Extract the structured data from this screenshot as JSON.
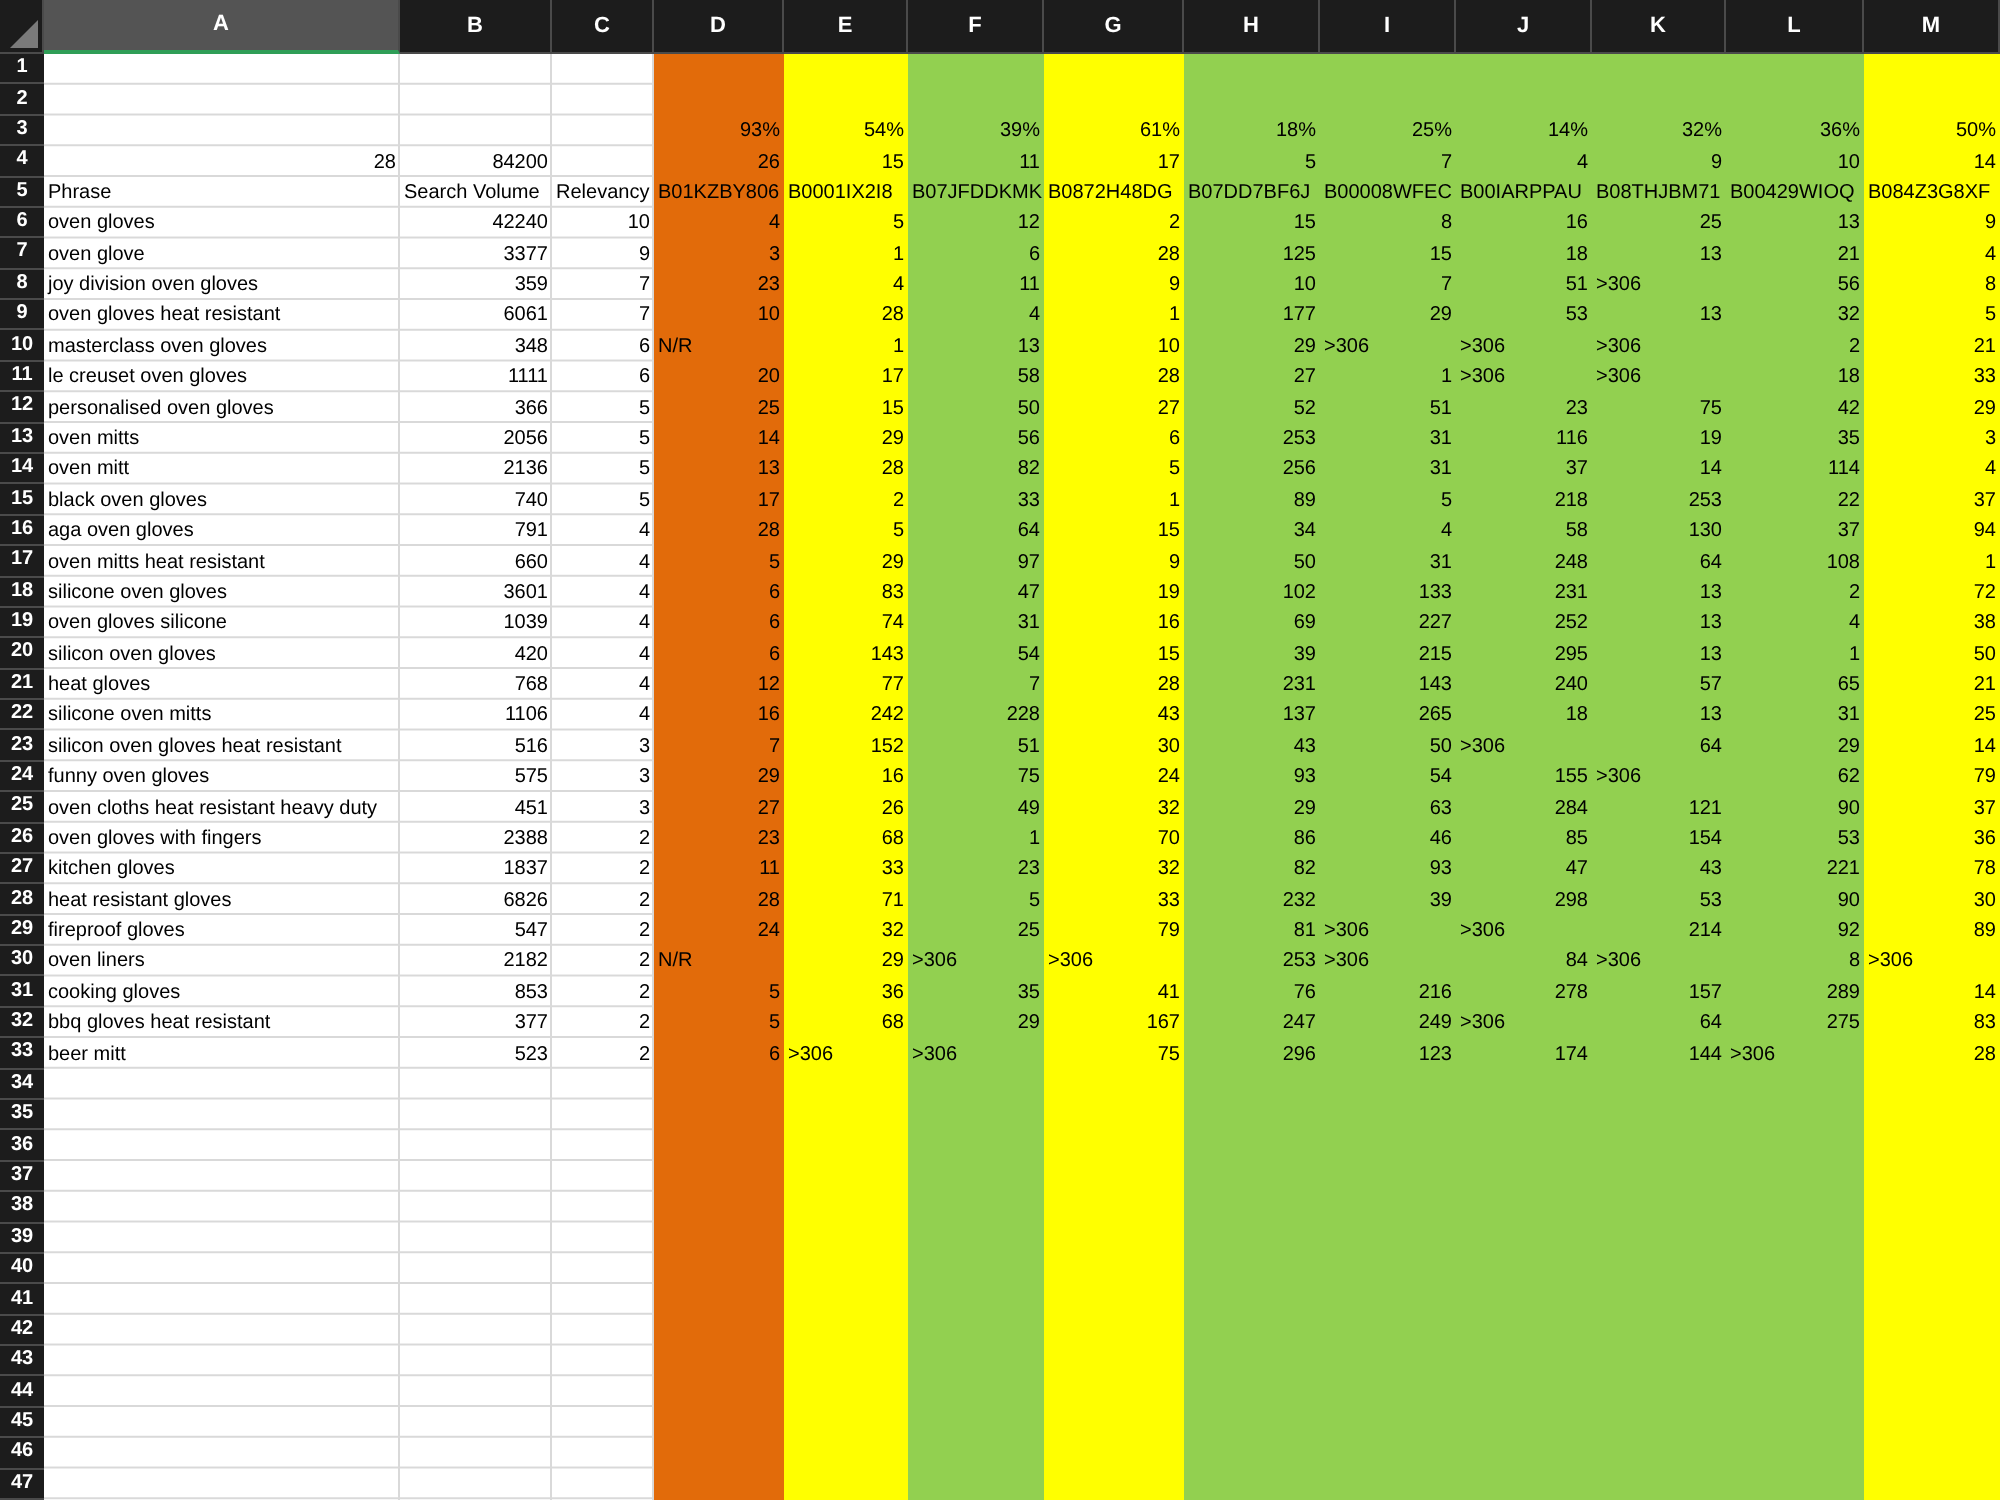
{
  "sheet": {
    "columns": [
      {
        "label": "A",
        "selected": true
      },
      {
        "label": "B",
        "selected": false
      },
      {
        "label": "C",
        "selected": false
      },
      {
        "label": "D",
        "selected": false,
        "color": "#e26b0a"
      },
      {
        "label": "E",
        "selected": false,
        "color": "#ffff00"
      },
      {
        "label": "F",
        "selected": false,
        "color": "#92d050"
      },
      {
        "label": "G",
        "selected": false,
        "color": "#ffff00"
      },
      {
        "label": "H",
        "selected": false,
        "color": "#92d050"
      },
      {
        "label": "I",
        "selected": false,
        "color": "#92d050"
      },
      {
        "label": "J",
        "selected": false,
        "color": "#92d050"
      },
      {
        "label": "K",
        "selected": false,
        "color": "#92d050"
      },
      {
        "label": "L",
        "selected": false,
        "color": "#92d050"
      },
      {
        "label": "M",
        "selected": false,
        "color": "#ffff00"
      }
    ],
    "rows": [
      {
        "number": "1"
      },
      {
        "number": "2"
      },
      {
        "number": "3",
        "cells": [
          null,
          null,
          null,
          {
            "kind": "number",
            "text": "93%"
          },
          {
            "kind": "number",
            "text": "54%"
          },
          {
            "kind": "number",
            "text": "39%"
          },
          {
            "kind": "number",
            "text": "61%"
          },
          {
            "kind": "number",
            "text": "18%"
          },
          {
            "kind": "number",
            "text": "25%"
          },
          {
            "kind": "number",
            "text": "14%"
          },
          {
            "kind": "number",
            "text": "32%"
          },
          {
            "kind": "number",
            "text": "36%"
          },
          {
            "kind": "number",
            "text": "50%"
          }
        ]
      },
      {
        "number": "4",
        "cells": [
          {
            "kind": "number",
            "text": "28"
          },
          {
            "kind": "number",
            "text": "84200"
          },
          null,
          {
            "kind": "number",
            "text": "26"
          },
          {
            "kind": "number",
            "text": "15"
          },
          {
            "kind": "number",
            "text": "11"
          },
          {
            "kind": "number",
            "text": "17"
          },
          {
            "kind": "number",
            "text": "5"
          },
          {
            "kind": "number",
            "text": "7"
          },
          {
            "kind": "number",
            "text": "4"
          },
          {
            "kind": "number",
            "text": "9"
          },
          {
            "kind": "number",
            "text": "10"
          },
          {
            "kind": "number",
            "text": "14"
          }
        ]
      },
      {
        "number": "5",
        "cells": [
          {
            "kind": "text",
            "text": "Phrase"
          },
          {
            "kind": "text",
            "text": "Search Volume"
          },
          {
            "kind": "text",
            "text": "Relevancy"
          },
          {
            "kind": "text",
            "text": "B01KZBY806"
          },
          {
            "kind": "text",
            "text": "B0001IX2I8"
          },
          {
            "kind": "text",
            "text": "B07JFDDKMK"
          },
          {
            "kind": "text",
            "text": "B0872H48DG"
          },
          {
            "kind": "text",
            "text": "B07DD7BF6J"
          },
          {
            "kind": "text",
            "text": "B00008WFEC"
          },
          {
            "kind": "text",
            "text": "B00IARPPAU"
          },
          {
            "kind": "text",
            "text": "B08THJBM71"
          },
          {
            "kind": "text",
            "text": "B00429WIOQ"
          },
          {
            "kind": "text",
            "text": "B084Z3G8XF"
          }
        ]
      },
      {
        "number": "6",
        "cells": [
          {
            "kind": "text",
            "text": "oven gloves"
          },
          {
            "kind": "number",
            "text": "42240"
          },
          {
            "kind": "number",
            "text": "10"
          },
          {
            "kind": "number",
            "text": "4"
          },
          {
            "kind": "number",
            "text": "5"
          },
          {
            "kind": "number",
            "text": "12"
          },
          {
            "kind": "number",
            "text": "2"
          },
          {
            "kind": "number",
            "text": "15"
          },
          {
            "kind": "number",
            "text": "8"
          },
          {
            "kind": "number",
            "text": "16"
          },
          {
            "kind": "number",
            "text": "25"
          },
          {
            "kind": "number",
            "text": "13"
          },
          {
            "kind": "number",
            "text": "9"
          }
        ]
      },
      {
        "number": "7",
        "cells": [
          {
            "kind": "text",
            "text": "oven glove"
          },
          {
            "kind": "number",
            "text": "3377"
          },
          {
            "kind": "number",
            "text": "9"
          },
          {
            "kind": "number",
            "text": "3"
          },
          {
            "kind": "number",
            "text": "1"
          },
          {
            "kind": "number",
            "text": "6"
          },
          {
            "kind": "number",
            "text": "28"
          },
          {
            "kind": "number",
            "text": "125"
          },
          {
            "kind": "number",
            "text": "15"
          },
          {
            "kind": "number",
            "text": "18"
          },
          {
            "kind": "number",
            "text": "13"
          },
          {
            "kind": "number",
            "text": "21"
          },
          {
            "kind": "number",
            "text": "4"
          }
        ]
      },
      {
        "number": "8",
        "cells": [
          {
            "kind": "text",
            "text": "joy division oven gloves"
          },
          {
            "kind": "number",
            "text": "359"
          },
          {
            "kind": "number",
            "text": "7"
          },
          {
            "kind": "number",
            "text": "23"
          },
          {
            "kind": "number",
            "text": "4"
          },
          {
            "kind": "number",
            "text": "11"
          },
          {
            "kind": "number",
            "text": "9"
          },
          {
            "kind": "number",
            "text": "10"
          },
          {
            "kind": "number",
            "text": "7"
          },
          {
            "kind": "number",
            "text": "51"
          },
          {
            "kind": "text",
            "text": ">306"
          },
          {
            "kind": "number",
            "text": "56"
          },
          {
            "kind": "number",
            "text": "8"
          }
        ]
      },
      {
        "number": "9",
        "cells": [
          {
            "kind": "text",
            "text": "oven gloves heat resistant"
          },
          {
            "kind": "number",
            "text": "6061"
          },
          {
            "kind": "number",
            "text": "7"
          },
          {
            "kind": "number",
            "text": "10"
          },
          {
            "kind": "number",
            "text": "28"
          },
          {
            "kind": "number",
            "text": "4"
          },
          {
            "kind": "number",
            "text": "1"
          },
          {
            "kind": "number",
            "text": "177"
          },
          {
            "kind": "number",
            "text": "29"
          },
          {
            "kind": "number",
            "text": "53"
          },
          {
            "kind": "number",
            "text": "13"
          },
          {
            "kind": "number",
            "text": "32"
          },
          {
            "kind": "number",
            "text": "5"
          }
        ]
      },
      {
        "number": "10",
        "cells": [
          {
            "kind": "text",
            "text": "masterclass oven gloves"
          },
          {
            "kind": "number",
            "text": "348"
          },
          {
            "kind": "number",
            "text": "6"
          },
          {
            "kind": "text",
            "text": "N/R"
          },
          {
            "kind": "number",
            "text": "1"
          },
          {
            "kind": "number",
            "text": "13"
          },
          {
            "kind": "number",
            "text": "10"
          },
          {
            "kind": "number",
            "text": "29"
          },
          {
            "kind": "text",
            "text": ">306"
          },
          {
            "kind": "text",
            "text": ">306"
          },
          {
            "kind": "text",
            "text": ">306"
          },
          {
            "kind": "number",
            "text": "2"
          },
          {
            "kind": "number",
            "text": "21"
          }
        ]
      },
      {
        "number": "11",
        "cells": [
          {
            "kind": "text",
            "text": "le creuset oven gloves"
          },
          {
            "kind": "number",
            "text": "1111"
          },
          {
            "kind": "number",
            "text": "6"
          },
          {
            "kind": "number",
            "text": "20"
          },
          {
            "kind": "number",
            "text": "17"
          },
          {
            "kind": "number",
            "text": "58"
          },
          {
            "kind": "number",
            "text": "28"
          },
          {
            "kind": "number",
            "text": "27"
          },
          {
            "kind": "number",
            "text": "1"
          },
          {
            "kind": "text",
            "text": ">306"
          },
          {
            "kind": "text",
            "text": ">306"
          },
          {
            "kind": "number",
            "text": "18"
          },
          {
            "kind": "number",
            "text": "33"
          }
        ]
      },
      {
        "number": "12",
        "cells": [
          {
            "kind": "text",
            "text": "personalised oven gloves"
          },
          {
            "kind": "number",
            "text": "366"
          },
          {
            "kind": "number",
            "text": "5"
          },
          {
            "kind": "number",
            "text": "25"
          },
          {
            "kind": "number",
            "text": "15"
          },
          {
            "kind": "number",
            "text": "50"
          },
          {
            "kind": "number",
            "text": "27"
          },
          {
            "kind": "number",
            "text": "52"
          },
          {
            "kind": "number",
            "text": "51"
          },
          {
            "kind": "number",
            "text": "23"
          },
          {
            "kind": "number",
            "text": "75"
          },
          {
            "kind": "number",
            "text": "42"
          },
          {
            "kind": "number",
            "text": "29"
          }
        ]
      },
      {
        "number": "13",
        "cells": [
          {
            "kind": "text",
            "text": "oven mitts"
          },
          {
            "kind": "number",
            "text": "2056"
          },
          {
            "kind": "number",
            "text": "5"
          },
          {
            "kind": "number",
            "text": "14"
          },
          {
            "kind": "number",
            "text": "29"
          },
          {
            "kind": "number",
            "text": "56"
          },
          {
            "kind": "number",
            "text": "6"
          },
          {
            "kind": "number",
            "text": "253"
          },
          {
            "kind": "number",
            "text": "31"
          },
          {
            "kind": "number",
            "text": "116"
          },
          {
            "kind": "number",
            "text": "19"
          },
          {
            "kind": "number",
            "text": "35"
          },
          {
            "kind": "number",
            "text": "3"
          }
        ]
      },
      {
        "number": "14",
        "cells": [
          {
            "kind": "text",
            "text": "oven mitt"
          },
          {
            "kind": "number",
            "text": "2136"
          },
          {
            "kind": "number",
            "text": "5"
          },
          {
            "kind": "number",
            "text": "13"
          },
          {
            "kind": "number",
            "text": "28"
          },
          {
            "kind": "number",
            "text": "82"
          },
          {
            "kind": "number",
            "text": "5"
          },
          {
            "kind": "number",
            "text": "256"
          },
          {
            "kind": "number",
            "text": "31"
          },
          {
            "kind": "number",
            "text": "37"
          },
          {
            "kind": "number",
            "text": "14"
          },
          {
            "kind": "number",
            "text": "114"
          },
          {
            "kind": "number",
            "text": "4"
          }
        ]
      },
      {
        "number": "15",
        "cells": [
          {
            "kind": "text",
            "text": "black oven gloves"
          },
          {
            "kind": "number",
            "text": "740"
          },
          {
            "kind": "number",
            "text": "5"
          },
          {
            "kind": "number",
            "text": "17"
          },
          {
            "kind": "number",
            "text": "2"
          },
          {
            "kind": "number",
            "text": "33"
          },
          {
            "kind": "number",
            "text": "1"
          },
          {
            "kind": "number",
            "text": "89"
          },
          {
            "kind": "number",
            "text": "5"
          },
          {
            "kind": "number",
            "text": "218"
          },
          {
            "kind": "number",
            "text": "253"
          },
          {
            "kind": "number",
            "text": "22"
          },
          {
            "kind": "number",
            "text": "37"
          }
        ]
      },
      {
        "number": "16",
        "cells": [
          {
            "kind": "text",
            "text": "aga oven gloves"
          },
          {
            "kind": "number",
            "text": "791"
          },
          {
            "kind": "number",
            "text": "4"
          },
          {
            "kind": "number",
            "text": "28"
          },
          {
            "kind": "number",
            "text": "5"
          },
          {
            "kind": "number",
            "text": "64"
          },
          {
            "kind": "number",
            "text": "15"
          },
          {
            "kind": "number",
            "text": "34"
          },
          {
            "kind": "number",
            "text": "4"
          },
          {
            "kind": "number",
            "text": "58"
          },
          {
            "kind": "number",
            "text": "130"
          },
          {
            "kind": "number",
            "text": "37"
          },
          {
            "kind": "number",
            "text": "94"
          }
        ]
      },
      {
        "number": "17",
        "cells": [
          {
            "kind": "text",
            "text": "oven mitts heat resistant"
          },
          {
            "kind": "number",
            "text": "660"
          },
          {
            "kind": "number",
            "text": "4"
          },
          {
            "kind": "number",
            "text": "5"
          },
          {
            "kind": "number",
            "text": "29"
          },
          {
            "kind": "number",
            "text": "97"
          },
          {
            "kind": "number",
            "text": "9"
          },
          {
            "kind": "number",
            "text": "50"
          },
          {
            "kind": "number",
            "text": "31"
          },
          {
            "kind": "number",
            "text": "248"
          },
          {
            "kind": "number",
            "text": "64"
          },
          {
            "kind": "number",
            "text": "108"
          },
          {
            "kind": "number",
            "text": "1"
          }
        ]
      },
      {
        "number": "18",
        "cells": [
          {
            "kind": "text",
            "text": "silicone oven gloves"
          },
          {
            "kind": "number",
            "text": "3601"
          },
          {
            "kind": "number",
            "text": "4"
          },
          {
            "kind": "number",
            "text": "6"
          },
          {
            "kind": "number",
            "text": "83"
          },
          {
            "kind": "number",
            "text": "47"
          },
          {
            "kind": "number",
            "text": "19"
          },
          {
            "kind": "number",
            "text": "102"
          },
          {
            "kind": "number",
            "text": "133"
          },
          {
            "kind": "number",
            "text": "231"
          },
          {
            "kind": "number",
            "text": "13"
          },
          {
            "kind": "number",
            "text": "2"
          },
          {
            "kind": "number",
            "text": "72"
          }
        ]
      },
      {
        "number": "19",
        "cells": [
          {
            "kind": "text",
            "text": "oven gloves silicone"
          },
          {
            "kind": "number",
            "text": "1039"
          },
          {
            "kind": "number",
            "text": "4"
          },
          {
            "kind": "number",
            "text": "6"
          },
          {
            "kind": "number",
            "text": "74"
          },
          {
            "kind": "number",
            "text": "31"
          },
          {
            "kind": "number",
            "text": "16"
          },
          {
            "kind": "number",
            "text": "69"
          },
          {
            "kind": "number",
            "text": "227"
          },
          {
            "kind": "number",
            "text": "252"
          },
          {
            "kind": "number",
            "text": "13"
          },
          {
            "kind": "number",
            "text": "4"
          },
          {
            "kind": "number",
            "text": "38"
          }
        ]
      },
      {
        "number": "20",
        "cells": [
          {
            "kind": "text",
            "text": "silicon oven gloves"
          },
          {
            "kind": "number",
            "text": "420"
          },
          {
            "kind": "number",
            "text": "4"
          },
          {
            "kind": "number",
            "text": "6"
          },
          {
            "kind": "number",
            "text": "143"
          },
          {
            "kind": "number",
            "text": "54"
          },
          {
            "kind": "number",
            "text": "15"
          },
          {
            "kind": "number",
            "text": "39"
          },
          {
            "kind": "number",
            "text": "215"
          },
          {
            "kind": "number",
            "text": "295"
          },
          {
            "kind": "number",
            "text": "13"
          },
          {
            "kind": "number",
            "text": "1"
          },
          {
            "kind": "number",
            "text": "50"
          }
        ]
      },
      {
        "number": "21",
        "cells": [
          {
            "kind": "text",
            "text": "heat gloves"
          },
          {
            "kind": "number",
            "text": "768"
          },
          {
            "kind": "number",
            "text": "4"
          },
          {
            "kind": "number",
            "text": "12"
          },
          {
            "kind": "number",
            "text": "77"
          },
          {
            "kind": "number",
            "text": "7"
          },
          {
            "kind": "number",
            "text": "28"
          },
          {
            "kind": "number",
            "text": "231"
          },
          {
            "kind": "number",
            "text": "143"
          },
          {
            "kind": "number",
            "text": "240"
          },
          {
            "kind": "number",
            "text": "57"
          },
          {
            "kind": "number",
            "text": "65"
          },
          {
            "kind": "number",
            "text": "21"
          }
        ]
      },
      {
        "number": "22",
        "cells": [
          {
            "kind": "text",
            "text": "silicone oven mitts"
          },
          {
            "kind": "number",
            "text": "1106"
          },
          {
            "kind": "number",
            "text": "4"
          },
          {
            "kind": "number",
            "text": "16"
          },
          {
            "kind": "number",
            "text": "242"
          },
          {
            "kind": "number",
            "text": "228"
          },
          {
            "kind": "number",
            "text": "43"
          },
          {
            "kind": "number",
            "text": "137"
          },
          {
            "kind": "number",
            "text": "265"
          },
          {
            "kind": "number",
            "text": "18"
          },
          {
            "kind": "number",
            "text": "13"
          },
          {
            "kind": "number",
            "text": "31"
          },
          {
            "kind": "number",
            "text": "25"
          }
        ]
      },
      {
        "number": "23",
        "cells": [
          {
            "kind": "text",
            "text": "silicon oven gloves heat resistant"
          },
          {
            "kind": "number",
            "text": "516"
          },
          {
            "kind": "number",
            "text": "3"
          },
          {
            "kind": "number",
            "text": "7"
          },
          {
            "kind": "number",
            "text": "152"
          },
          {
            "kind": "number",
            "text": "51"
          },
          {
            "kind": "number",
            "text": "30"
          },
          {
            "kind": "number",
            "text": "43"
          },
          {
            "kind": "number",
            "text": "50"
          },
          {
            "kind": "text",
            "text": ">306"
          },
          {
            "kind": "number",
            "text": "64"
          },
          {
            "kind": "number",
            "text": "29"
          },
          {
            "kind": "number",
            "text": "14"
          }
        ]
      },
      {
        "number": "24",
        "cells": [
          {
            "kind": "text",
            "text": "funny oven gloves"
          },
          {
            "kind": "number",
            "text": "575"
          },
          {
            "kind": "number",
            "text": "3"
          },
          {
            "kind": "number",
            "text": "29"
          },
          {
            "kind": "number",
            "text": "16"
          },
          {
            "kind": "number",
            "text": "75"
          },
          {
            "kind": "number",
            "text": "24"
          },
          {
            "kind": "number",
            "text": "93"
          },
          {
            "kind": "number",
            "text": "54"
          },
          {
            "kind": "number",
            "text": "155"
          },
          {
            "kind": "text",
            "text": ">306"
          },
          {
            "kind": "number",
            "text": "62"
          },
          {
            "kind": "number",
            "text": "79"
          }
        ]
      },
      {
        "number": "25",
        "cells": [
          {
            "kind": "text",
            "text": "oven cloths heat resistant heavy duty"
          },
          {
            "kind": "number",
            "text": "451"
          },
          {
            "kind": "number",
            "text": "3"
          },
          {
            "kind": "number",
            "text": "27"
          },
          {
            "kind": "number",
            "text": "26"
          },
          {
            "kind": "number",
            "text": "49"
          },
          {
            "kind": "number",
            "text": "32"
          },
          {
            "kind": "number",
            "text": "29"
          },
          {
            "kind": "number",
            "text": "63"
          },
          {
            "kind": "number",
            "text": "284"
          },
          {
            "kind": "number",
            "text": "121"
          },
          {
            "kind": "number",
            "text": "90"
          },
          {
            "kind": "number",
            "text": "37"
          }
        ]
      },
      {
        "number": "26",
        "cells": [
          {
            "kind": "text",
            "text": "oven gloves with fingers"
          },
          {
            "kind": "number",
            "text": "2388"
          },
          {
            "kind": "number",
            "text": "2"
          },
          {
            "kind": "number",
            "text": "23"
          },
          {
            "kind": "number",
            "text": "68"
          },
          {
            "kind": "number",
            "text": "1"
          },
          {
            "kind": "number",
            "text": "70"
          },
          {
            "kind": "number",
            "text": "86"
          },
          {
            "kind": "number",
            "text": "46"
          },
          {
            "kind": "number",
            "text": "85"
          },
          {
            "kind": "number",
            "text": "154"
          },
          {
            "kind": "number",
            "text": "53"
          },
          {
            "kind": "number",
            "text": "36"
          }
        ]
      },
      {
        "number": "27",
        "cells": [
          {
            "kind": "text",
            "text": "kitchen gloves"
          },
          {
            "kind": "number",
            "text": "1837"
          },
          {
            "kind": "number",
            "text": "2"
          },
          {
            "kind": "number",
            "text": "11"
          },
          {
            "kind": "number",
            "text": "33"
          },
          {
            "kind": "number",
            "text": "23"
          },
          {
            "kind": "number",
            "text": "32"
          },
          {
            "kind": "number",
            "text": "82"
          },
          {
            "kind": "number",
            "text": "93"
          },
          {
            "kind": "number",
            "text": "47"
          },
          {
            "kind": "number",
            "text": "43"
          },
          {
            "kind": "number",
            "text": "221"
          },
          {
            "kind": "number",
            "text": "78"
          }
        ]
      },
      {
        "number": "28",
        "cells": [
          {
            "kind": "text",
            "text": "heat resistant gloves"
          },
          {
            "kind": "number",
            "text": "6826"
          },
          {
            "kind": "number",
            "text": "2"
          },
          {
            "kind": "number",
            "text": "28"
          },
          {
            "kind": "number",
            "text": "71"
          },
          {
            "kind": "number",
            "text": "5"
          },
          {
            "kind": "number",
            "text": "33"
          },
          {
            "kind": "number",
            "text": "232"
          },
          {
            "kind": "number",
            "text": "39"
          },
          {
            "kind": "number",
            "text": "298"
          },
          {
            "kind": "number",
            "text": "53"
          },
          {
            "kind": "number",
            "text": "90"
          },
          {
            "kind": "number",
            "text": "30"
          }
        ]
      },
      {
        "number": "29",
        "cells": [
          {
            "kind": "text",
            "text": "fireproof gloves"
          },
          {
            "kind": "number",
            "text": "547"
          },
          {
            "kind": "number",
            "text": "2"
          },
          {
            "kind": "number",
            "text": "24"
          },
          {
            "kind": "number",
            "text": "32"
          },
          {
            "kind": "number",
            "text": "25"
          },
          {
            "kind": "number",
            "text": "79"
          },
          {
            "kind": "number",
            "text": "81"
          },
          {
            "kind": "text",
            "text": ">306"
          },
          {
            "kind": "text",
            "text": ">306"
          },
          {
            "kind": "number",
            "text": "214"
          },
          {
            "kind": "number",
            "text": "92"
          },
          {
            "kind": "number",
            "text": "89"
          }
        ]
      },
      {
        "number": "30",
        "cells": [
          {
            "kind": "text",
            "text": "oven liners"
          },
          {
            "kind": "number",
            "text": "2182"
          },
          {
            "kind": "number",
            "text": "2"
          },
          {
            "kind": "text",
            "text": "N/R"
          },
          {
            "kind": "number",
            "text": "29"
          },
          {
            "kind": "text",
            "text": ">306"
          },
          {
            "kind": "text",
            "text": ">306"
          },
          {
            "kind": "number",
            "text": "253"
          },
          {
            "kind": "text",
            "text": ">306"
          },
          {
            "kind": "number",
            "text": "84"
          },
          {
            "kind": "text",
            "text": ">306"
          },
          {
            "kind": "number",
            "text": "8"
          },
          {
            "kind": "text",
            "text": ">306"
          }
        ]
      },
      {
        "number": "31",
        "cells": [
          {
            "kind": "text",
            "text": "cooking gloves"
          },
          {
            "kind": "number",
            "text": "853"
          },
          {
            "kind": "number",
            "text": "2"
          },
          {
            "kind": "number",
            "text": "5"
          },
          {
            "kind": "number",
            "text": "36"
          },
          {
            "kind": "number",
            "text": "35"
          },
          {
            "kind": "number",
            "text": "41"
          },
          {
            "kind": "number",
            "text": "76"
          },
          {
            "kind": "number",
            "text": "216"
          },
          {
            "kind": "number",
            "text": "278"
          },
          {
            "kind": "number",
            "text": "157"
          },
          {
            "kind": "number",
            "text": "289"
          },
          {
            "kind": "number",
            "text": "14"
          }
        ]
      },
      {
        "number": "32",
        "cells": [
          {
            "kind": "text",
            "text": "bbq gloves heat resistant"
          },
          {
            "kind": "number",
            "text": "377"
          },
          {
            "kind": "number",
            "text": "2"
          },
          {
            "kind": "number",
            "text": "5"
          },
          {
            "kind": "number",
            "text": "68"
          },
          {
            "kind": "number",
            "text": "29"
          },
          {
            "kind": "number",
            "text": "167"
          },
          {
            "kind": "number",
            "text": "247"
          },
          {
            "kind": "number",
            "text": "249"
          },
          {
            "kind": "text",
            "text": ">306"
          },
          {
            "kind": "number",
            "text": "64"
          },
          {
            "kind": "number",
            "text": "275"
          },
          {
            "kind": "number",
            "text": "83"
          }
        ]
      },
      {
        "number": "33",
        "cells": [
          {
            "kind": "text",
            "text": "beer mitt"
          },
          {
            "kind": "number",
            "text": "523"
          },
          {
            "kind": "number",
            "text": "2"
          },
          {
            "kind": "number",
            "text": "6"
          },
          {
            "kind": "text",
            "text": ">306"
          },
          {
            "kind": "text",
            "text": ">306"
          },
          {
            "kind": "number",
            "text": "75"
          },
          {
            "kind": "number",
            "text": "296"
          },
          {
            "kind": "number",
            "text": "123"
          },
          {
            "kind": "number",
            "text": "174"
          },
          {
            "kind": "number",
            "text": "144"
          },
          {
            "kind": "text",
            "text": ">306"
          },
          {
            "kind": "number",
            "text": "28"
          }
        ]
      },
      {
        "number": "34"
      },
      {
        "number": "35"
      },
      {
        "number": "36"
      },
      {
        "number": "37"
      },
      {
        "number": "38"
      },
      {
        "number": "39"
      },
      {
        "number": "40"
      },
      {
        "number": "41"
      },
      {
        "number": "42"
      },
      {
        "number": "43"
      },
      {
        "number": "44"
      },
      {
        "number": "45"
      },
      {
        "number": "46"
      },
      {
        "number": "47"
      }
    ]
  }
}
